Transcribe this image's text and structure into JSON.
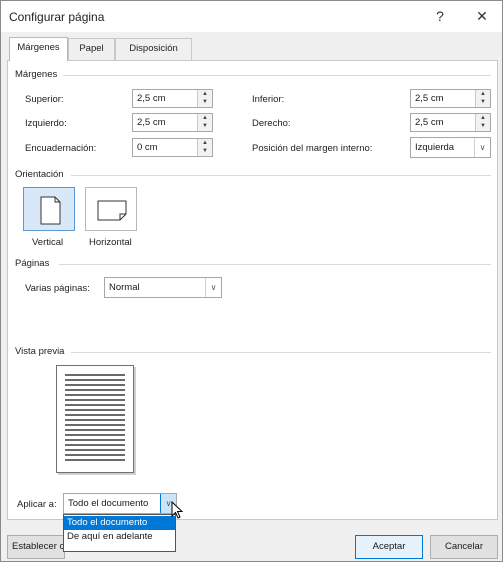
{
  "window": {
    "title": "Configurar página",
    "help": "?",
    "close": "✕"
  },
  "tabs": [
    {
      "label": "Márgenes",
      "active": true
    },
    {
      "label": "Papel",
      "active": false
    },
    {
      "label": "Disposición",
      "active": false
    }
  ],
  "margins": {
    "section": "Márgenes",
    "top": {
      "label": "Superior:",
      "value": "2,5 cm"
    },
    "left": {
      "label": "Izquierdo:",
      "value": "2,5 cm"
    },
    "gutter": {
      "label": "Encuadernación:",
      "value": "0 cm"
    },
    "bottom": {
      "label": "Inferior:",
      "value": "2,5 cm"
    },
    "right": {
      "label": "Derecho:",
      "value": "2,5 cm"
    },
    "gutter_pos": {
      "label": "Posición del margen interno:",
      "value": "Izquierda"
    }
  },
  "orientation": {
    "section": "Orientación",
    "portrait": "Vertical",
    "landscape": "Horizontal"
  },
  "pages": {
    "section": "Páginas",
    "multiple_label": "Varias páginas:",
    "multiple_value": "Normal"
  },
  "preview": {
    "section": "Vista previa"
  },
  "apply": {
    "label": "Aplicar a:",
    "value": "Todo el documento",
    "options": [
      "Todo el documento",
      "De aquí en adelante"
    ]
  },
  "buttons": {
    "default": "Establecer c",
    "ok": "Aceptar",
    "cancel": "Cancelar"
  },
  "colors": {
    "accent": "#0078d7",
    "selected_bg": "#d8e8f8"
  }
}
